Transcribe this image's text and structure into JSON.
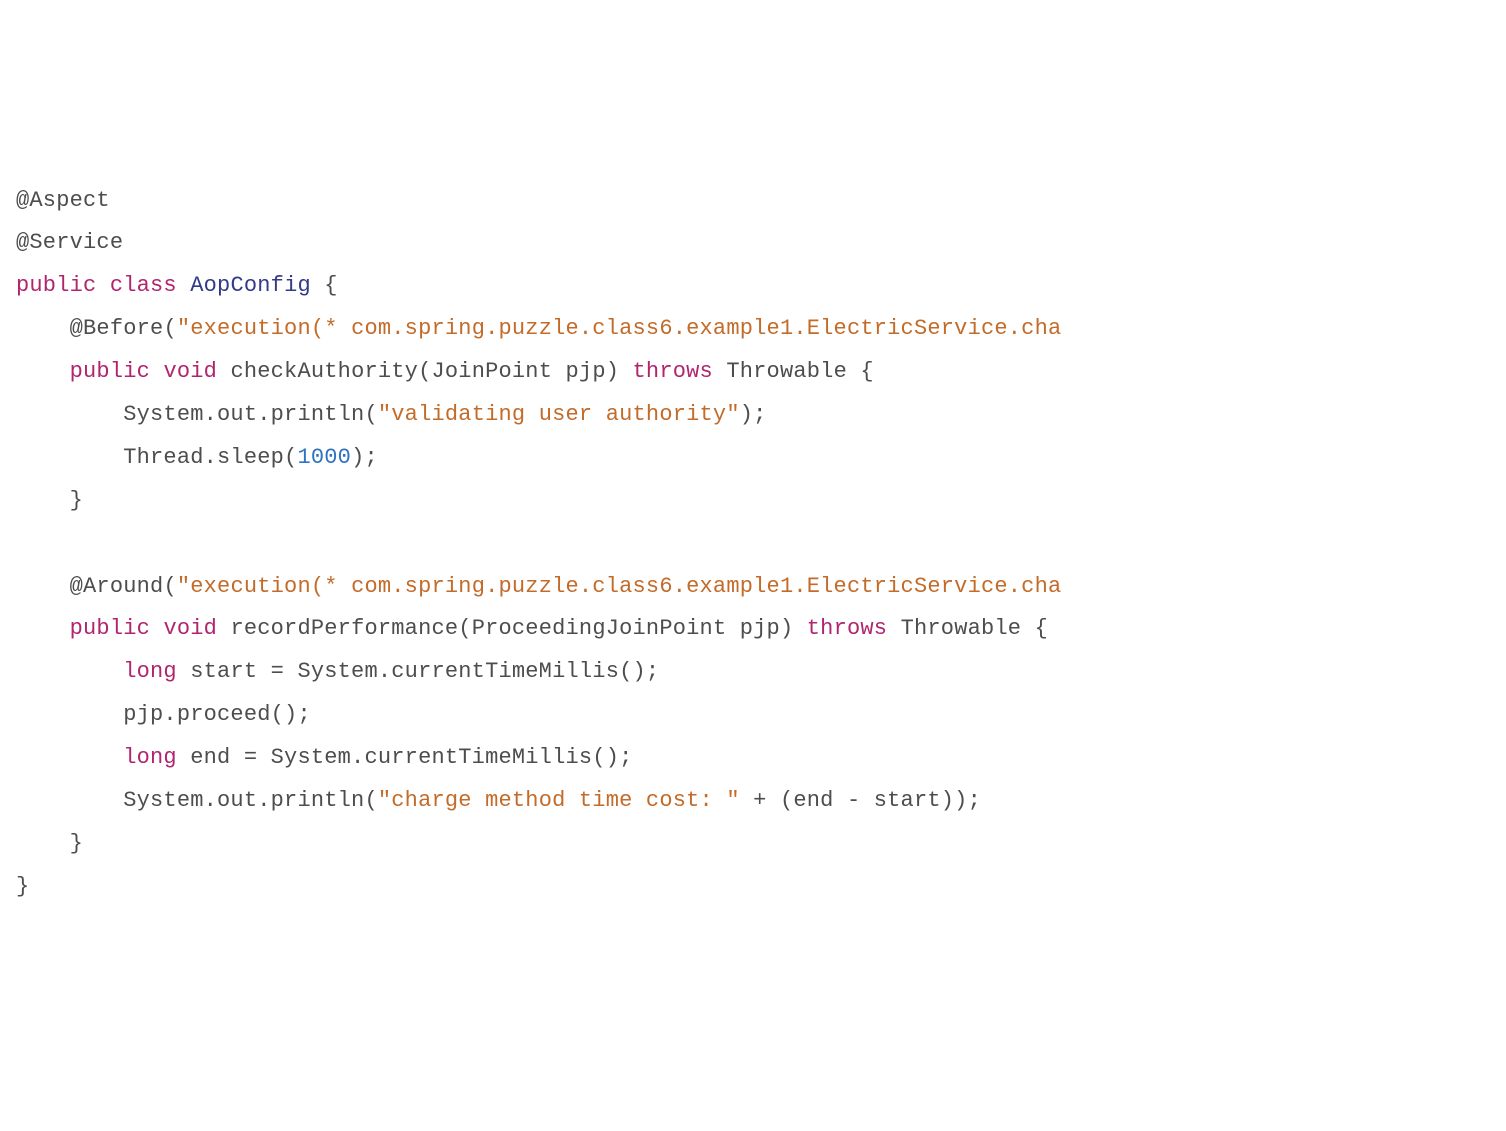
{
  "code": {
    "t_aspect": "@Aspect",
    "t_service": "@Service",
    "t_public1": "public",
    "t_class": "class",
    "t_classname": "AopConfig",
    "t_lbrace1": " {",
    "indent1": "    ",
    "indent2": "        ",
    "t_before": "@Before",
    "t_beforearg": "(",
    "t_beforestr": "\"execution(* com.spring.puzzle.class6.example1.ElectricService.cha",
    "t_public2": "public",
    "t_void1": "void",
    "t_checkauth": " checkAuthority",
    "t_checkauth_params": "(JoinPoint pjp) ",
    "t_throws1": "throws",
    "t_throwable1": " Throwable {",
    "t_sysout1a": "System.out.println(",
    "t_str_validating": "\"validating user authority\"",
    "t_sysout1b": ");",
    "t_threadsleep_a": "Thread.sleep(",
    "t_1000": "1000",
    "t_threadsleep_b": ");",
    "t_rbrace_m1": "}",
    "t_around": "@Around",
    "t_aroundarg": "(",
    "t_aroundstr": "\"execution(* com.spring.puzzle.class6.example1.ElectricService.cha",
    "t_public3": "public",
    "t_void2": "void",
    "t_recordperf": " recordPerformance",
    "t_recordperf_params": "(ProceedingJoinPoint pjp) ",
    "t_throws2": "throws",
    "t_throwable2": " Throwable {",
    "t_long1": "long",
    "t_start_assign": " start = System.currentTimeMillis();",
    "t_pjp_proceed": "pjp.proceed();",
    "t_long2": "long",
    "t_end_assign": " end = System.currentTimeMillis();",
    "t_sysout2a": "System.out.println(",
    "t_str_charge": "\"charge method time cost: \"",
    "t_sysout2b": " + (end - start));",
    "t_rbrace_m2": "}",
    "t_rbrace_class": "}"
  }
}
